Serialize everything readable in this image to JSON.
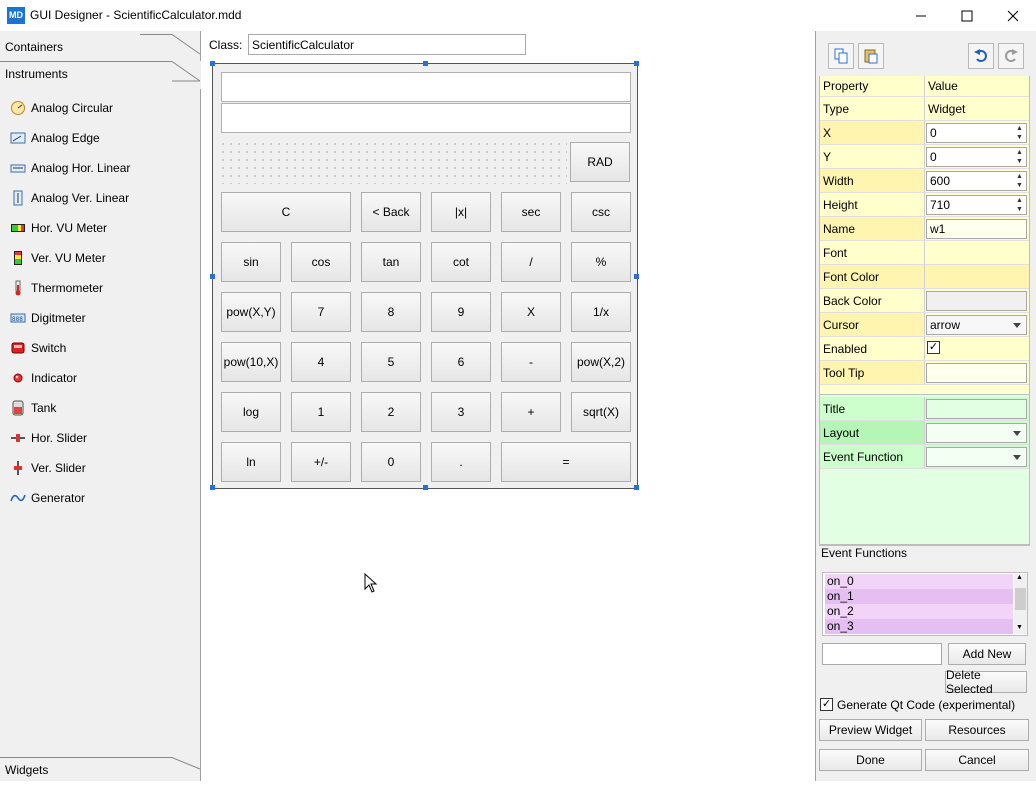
{
  "window": {
    "app_icon": "MD",
    "title": "GUI Designer - ScientificCalculator.mdd",
    "minimize_icon": "minimize-icon",
    "maximize_icon": "maximize-icon",
    "close_icon": "close-icon"
  },
  "left_panel": {
    "tabs": [
      "Containers",
      "Instruments",
      "Widgets"
    ],
    "instruments": [
      {
        "label": "Analog Circular",
        "icon": "analog-circular-icon"
      },
      {
        "label": "Analog Edge",
        "icon": "analog-edge-icon"
      },
      {
        "label": "Analog Hor. Linear",
        "icon": "analog-hor-linear-icon"
      },
      {
        "label": "Analog Ver. Linear",
        "icon": "analog-ver-linear-icon"
      },
      {
        "label": "Hor. VU Meter",
        "icon": "hor-vu-meter-icon"
      },
      {
        "label": "Ver. VU Meter",
        "icon": "ver-vu-meter-icon"
      },
      {
        "label": "Thermometer",
        "icon": "thermometer-icon"
      },
      {
        "label": "Digitmeter",
        "icon": "digitmeter-icon"
      },
      {
        "label": "Switch",
        "icon": "switch-icon"
      },
      {
        "label": "Indicator",
        "icon": "indicator-icon"
      },
      {
        "label": "Tank",
        "icon": "tank-icon"
      },
      {
        "label": "Hor. Slider",
        "icon": "hor-slider-icon"
      },
      {
        "label": "Ver. Slider",
        "icon": "ver-slider-icon"
      },
      {
        "label": "Generator",
        "icon": "generator-icon"
      }
    ]
  },
  "canvas": {
    "class_label": "Class:",
    "class_value": "ScientificCalculator",
    "buttons": {
      "rad": "RAD",
      "row1": [
        "C",
        "< Back",
        "|x|",
        "sec",
        "csc"
      ],
      "row2": [
        "sin",
        "cos",
        "tan",
        "cot",
        "/",
        "%"
      ],
      "row3": [
        "pow(X,Y)",
        "7",
        "8",
        "9",
        "X",
        "1/x"
      ],
      "row4": [
        "pow(10,X)",
        "4",
        "5",
        "6",
        "-",
        "pow(X,2)"
      ],
      "row5": [
        "log",
        "1",
        "2",
        "3",
        "+",
        "sqrt(X)"
      ],
      "row6": [
        "ln",
        "+/-",
        "0",
        ".",
        "="
      ]
    }
  },
  "right_panel": {
    "toolbar_icons": [
      "copy-icon",
      "paste-icon",
      "undo-icon",
      "redo-icon"
    ],
    "header": {
      "property": "Property",
      "value": "Value"
    },
    "properties": {
      "type": {
        "name": "Type",
        "value": "Widget"
      },
      "x": {
        "name": "X",
        "value": "0"
      },
      "y": {
        "name": "Y",
        "value": "0"
      },
      "width": {
        "name": "Width",
        "value": "600"
      },
      "height": {
        "name": "Height",
        "value": "710"
      },
      "name": {
        "name": "Name",
        "value": "w1"
      },
      "font": {
        "name": "Font",
        "value": ""
      },
      "font_color": {
        "name": "Font Color",
        "value": ""
      },
      "back_color": {
        "name": "Back Color",
        "value": ""
      },
      "cursor": {
        "name": "Cursor",
        "value": "arrow"
      },
      "enabled": {
        "name": "Enabled",
        "value": "✓"
      },
      "tool_tip": {
        "name": "Tool Tip",
        "value": ""
      }
    },
    "extra": {
      "title": {
        "name": "Title",
        "value": ""
      },
      "layout": {
        "name": "Layout",
        "value": ""
      },
      "event_function": {
        "name": "Event Function",
        "value": ""
      }
    },
    "event_functions_label": "Event Functions",
    "event_functions": [
      "on_0",
      "on_1",
      "on_2",
      "on_3"
    ],
    "add_new": "Add New",
    "delete_selected": "Delete Selected",
    "generate_qt_checked": "✓",
    "generate_qt_label": "Generate Qt Code (experimental)",
    "preview_widget": "Preview Widget",
    "resources": "Resources",
    "done": "Done",
    "cancel": "Cancel"
  },
  "colors": {
    "prop_yellow": "#ffffcc",
    "prop_yellow_dark": "#fff5b0",
    "extra_green": "#ccffcc",
    "extra_green_light": "#e3ffe3",
    "event_purple": "#f1d4f8",
    "event_purple_dark": "#e6bff2"
  }
}
